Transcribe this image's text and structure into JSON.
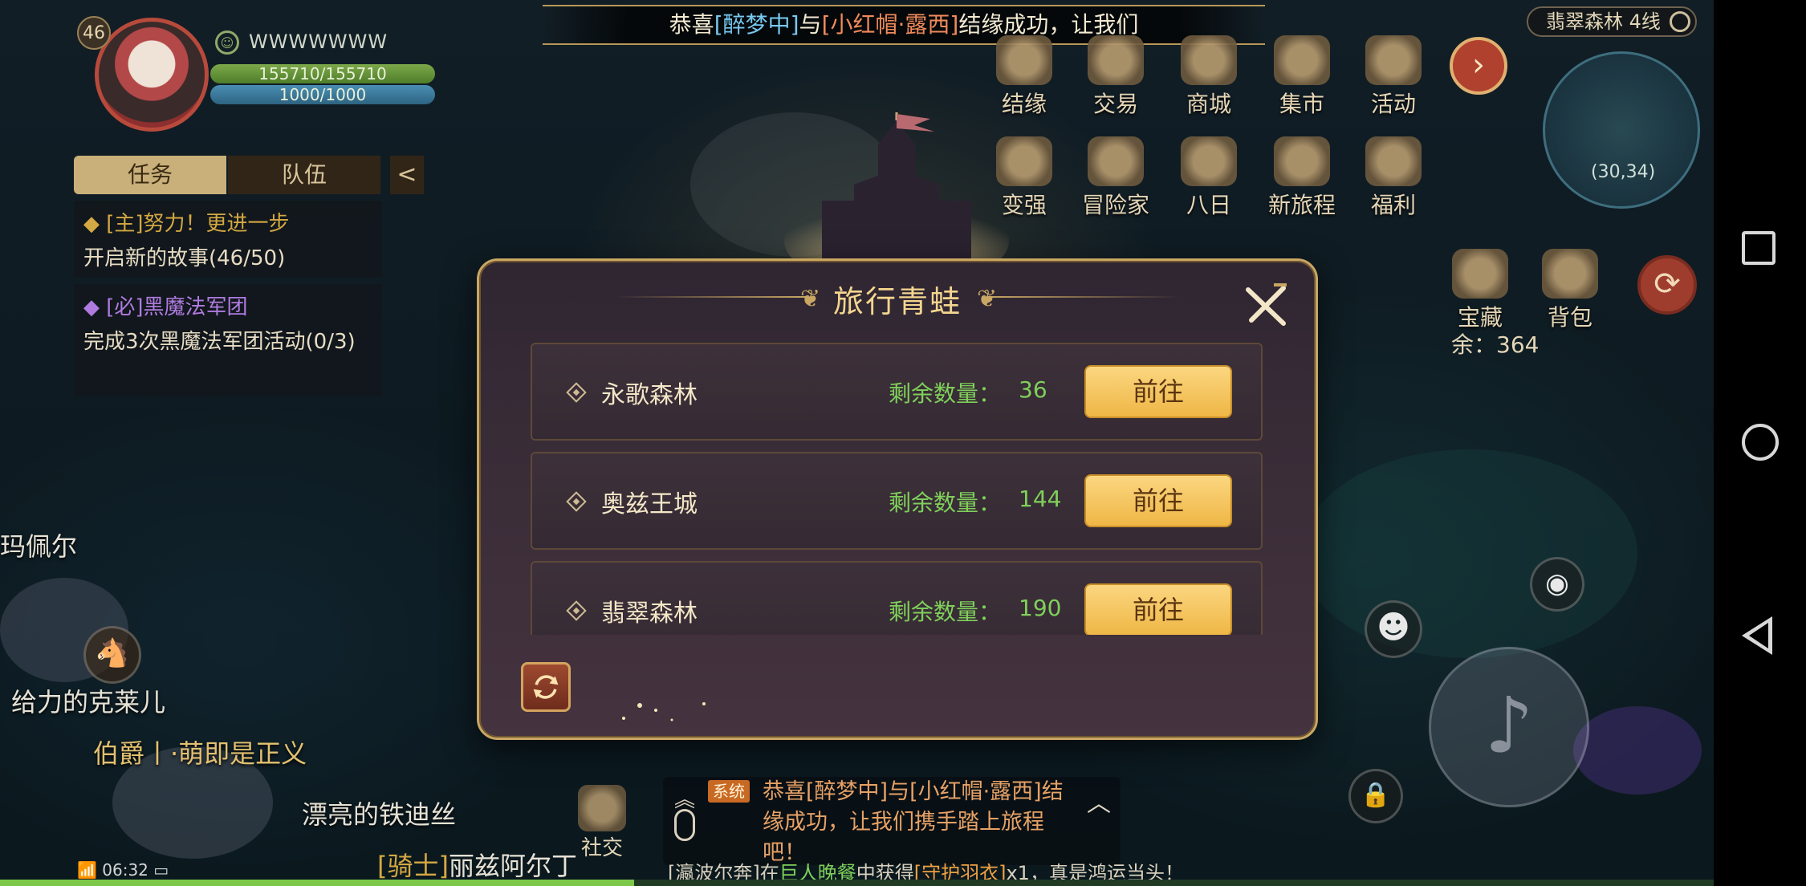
{
  "player": {
    "level": "46",
    "name": "WWWWWWW",
    "hp": "155710/155710",
    "mp": "1000/1000"
  },
  "quest_panel": {
    "tabs": [
      "任务",
      "队伍"
    ],
    "collapse": "<",
    "quests": [
      {
        "title": "◆ [主]努力！更进一步",
        "desc": "开启新的故事(46/50)"
      },
      {
        "title": "◆ [必]黑魔法军团",
        "desc": "完成3次黑魔法军团活动(0/3)"
      }
    ]
  },
  "banner": {
    "prefix": "恭喜",
    "name1": "[醉梦中]",
    "mid": "与",
    "name2": "[小红帽·露西]",
    "suffix": "结缘成功，让我们"
  },
  "functions_row1": [
    "结缘",
    "交易",
    "商城",
    "集市",
    "活动"
  ],
  "functions_row2": [
    "变强",
    "冒险家",
    "八日",
    "新旅程",
    "福利"
  ],
  "side_functions": [
    "宝藏",
    "背包"
  ],
  "channel": "翡翠森林  4线",
  "coords": "(30,34)",
  "treasure_count": "余：364",
  "npc_names": [
    "玛佩尔",
    "给力的克莱儿",
    "伯爵丨·萌即是正义",
    "漂亮的铁迪丝"
  ],
  "bottom": {
    "social_label": "社交",
    "time": "06:32",
    "name_tag": "[骑士]",
    "name": "丽兹阿尔丁",
    "chat_tag": "系统",
    "chat_text": "恭喜[醉梦中]与[小红帽·露西]结缘成功，让我们携手踏上旅程吧！",
    "ticker": {
      "p1": "[瀛波尔奔]在",
      "place": "巨人晚餐",
      "p2": "中获得",
      "item": "[守护羽衣]",
      "p3": "x1，真是鸿运当头！"
    },
    "xp_progress": 0.37
  },
  "modal": {
    "title": "旅行青蛙",
    "count_label": "剩余数量：",
    "go_label": "前往",
    "rows": [
      {
        "name": "永歌森林",
        "count": "36"
      },
      {
        "name": "奥兹王城",
        "count": "144"
      },
      {
        "name": "翡翠森林",
        "count": "190"
      }
    ]
  },
  "colors": {
    "gold": "#c9a763",
    "go_button": "#f4c660",
    "count_green": "#7fd05a",
    "modal_bg": "#3a2d38"
  }
}
